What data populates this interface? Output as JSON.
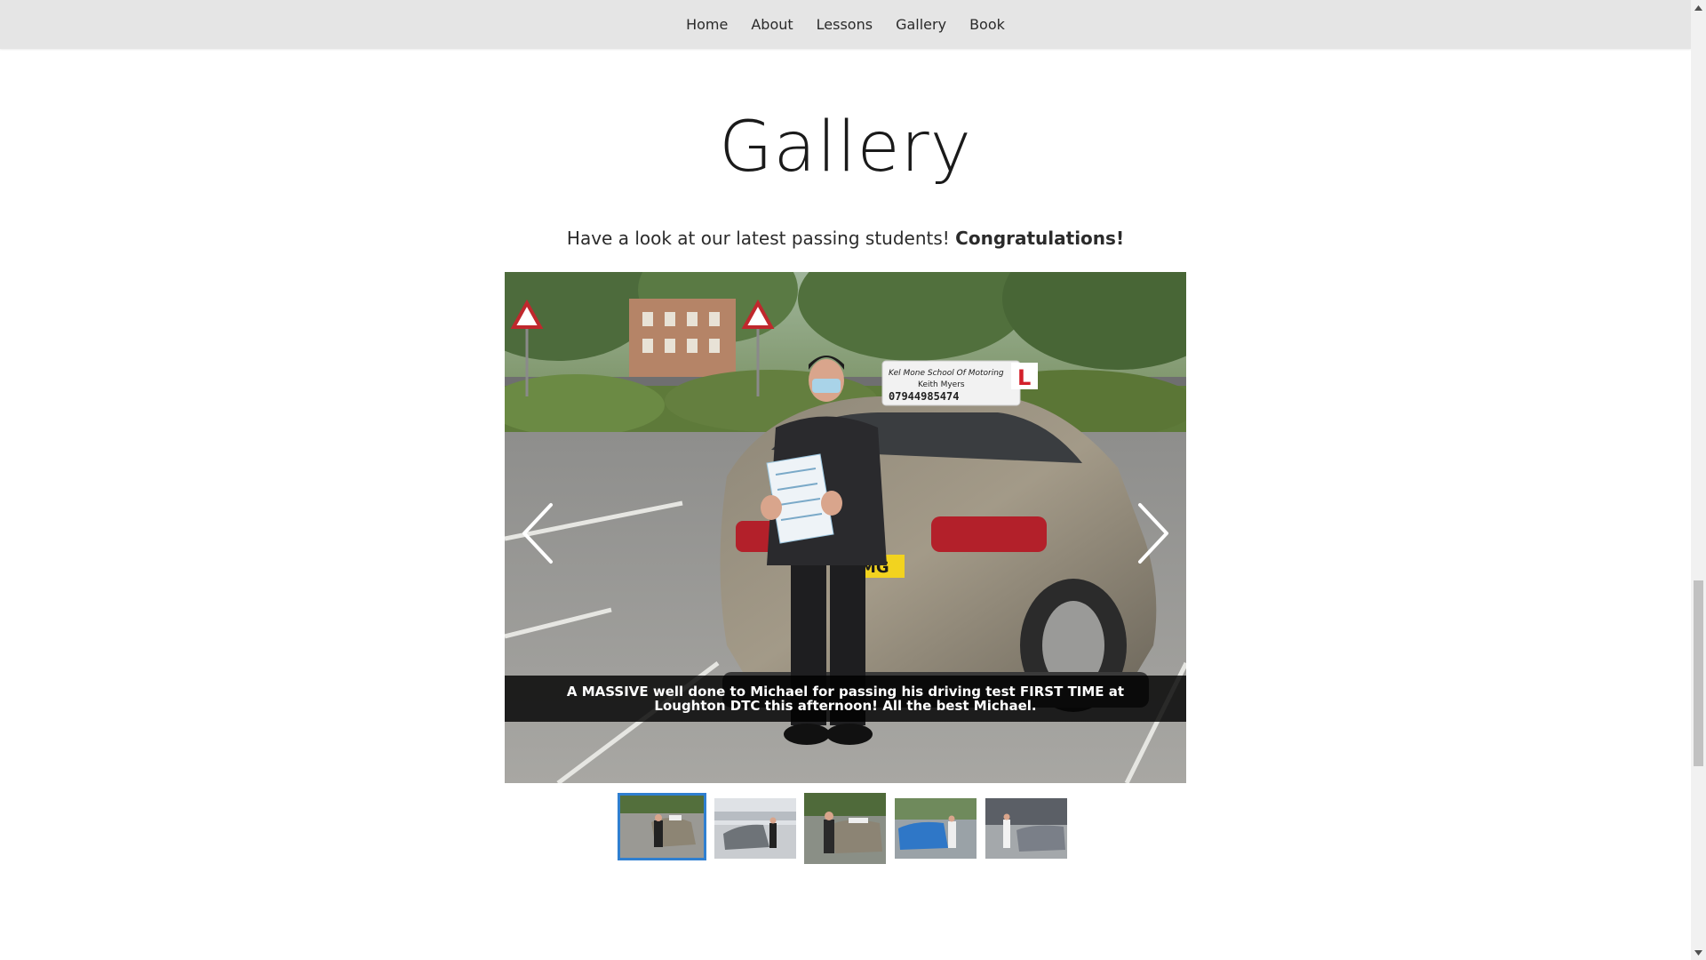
{
  "nav": {
    "items": [
      {
        "label": "Home"
      },
      {
        "label": "About"
      },
      {
        "label": "Lessons"
      },
      {
        "label": "Gallery"
      },
      {
        "label": "Book"
      }
    ]
  },
  "page": {
    "title": "Gallery",
    "subtitle_text": "Have a look at our latest passing students!",
    "subtitle_bold": "Congratulations!"
  },
  "slider": {
    "caption": "A MASSIVE well done to Michael for passing his driving test FIRST TIME at Loughton DTC this afternoon! All the best Michael.",
    "photo": {
      "sign_line1": "Kel Mone School Of Motoring",
      "sign_line2": "Keith Myers",
      "sign_phone": "07944985474",
      "sign_letter": "L",
      "plate_text": "MG"
    },
    "prev_icon": "chevron-left-icon",
    "next_icon": "chevron-right-icon",
    "active_index": 0,
    "thumbnail_count": 5
  },
  "colors": {
    "nav_bg": "#e5e5e5",
    "active_thumb_border": "#2f7fd0",
    "caption_bg": "#000000"
  }
}
